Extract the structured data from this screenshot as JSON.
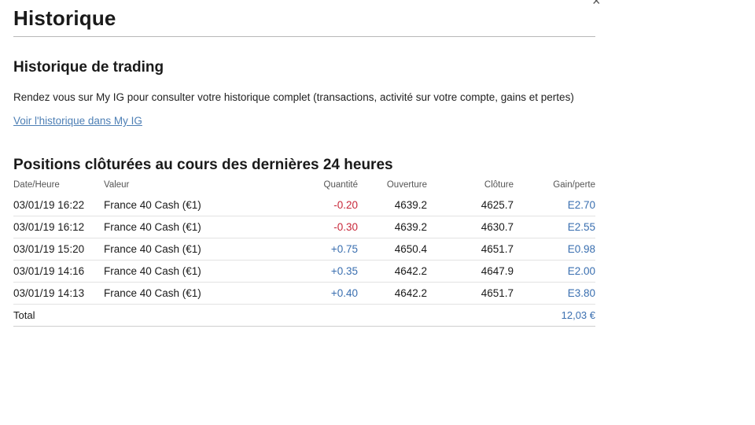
{
  "header": {
    "title": "Historique",
    "close_glyph": "×"
  },
  "trading": {
    "title": "Historique de trading",
    "description": "Rendez vous sur My IG pour consulter votre historique complet (transactions, activité sur votre compte, gains et pertes)",
    "link_label": "Voir l'historique dans My IG"
  },
  "positions": {
    "title": "Positions clôturées au cours des dernières 24 heures",
    "columns": [
      "Date/Heure",
      "Valeur",
      "Quantité",
      "Ouverture",
      "Clôture",
      "Gain/perte"
    ],
    "rows": [
      {
        "date": "03/01/19 16:22",
        "value": "France 40 Cash (€1)",
        "qty": "-0.20",
        "open": "4639.2",
        "close": "4625.7",
        "gain": "E2.70"
      },
      {
        "date": "03/01/19 16:12",
        "value": "France 40 Cash (€1)",
        "qty": "-0.30",
        "open": "4639.2",
        "close": "4630.7",
        "gain": "E2.55"
      },
      {
        "date": "03/01/19 15:20",
        "value": "France 40 Cash (€1)",
        "qty": "+0.75",
        "open": "4650.4",
        "close": "4651.7",
        "gain": "E0.98"
      },
      {
        "date": "03/01/19 14:16",
        "value": "France 40 Cash (€1)",
        "qty": "+0.35",
        "open": "4642.2",
        "close": "4647.9",
        "gain": "E2.00"
      },
      {
        "date": "03/01/19 14:13",
        "value": "France 40 Cash (€1)",
        "qty": "+0.40",
        "open": "4642.2",
        "close": "4651.7",
        "gain": "E3.80"
      }
    ],
    "total_label": "Total",
    "total_value": "12,03 €"
  },
  "colors": {
    "negative": "#c8283a",
    "positive": "#3a6fb0",
    "link": "#4d7fb5"
  }
}
